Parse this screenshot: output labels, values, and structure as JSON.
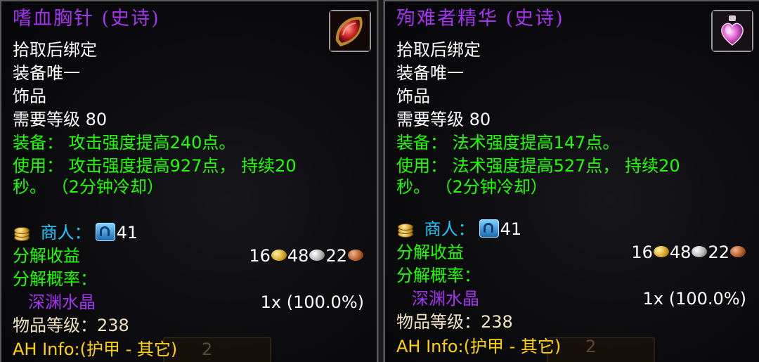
{
  "tooltips": [
    {
      "name": "嗜血胸针 (史诗)",
      "bind": "拾取后绑定",
      "unique": "装备唯一",
      "slot": "饰品",
      "req_level": "需要等级 80",
      "equip": "装备：  攻击强度提高240点。",
      "use_line1": "使用：  攻击强度提高927点， 持续20",
      "use_line2": "秒。  （2分钟冷却）",
      "vendor_label": "商人：",
      "vendor_amount": "41",
      "disenchant_label": "分解收益",
      "disenchant_gold": "16",
      "disenchant_silver": "48",
      "disenchant_copper": "22",
      "chance_label": "分解概率：",
      "material": "深渊水晶",
      "material_rate": "1x (100.0%)",
      "item_level": "物品等级：238",
      "ah_info": "AH Info:(护甲 - 其它)",
      "ghost_text": "2",
      "icon": "red-brooch-icon"
    },
    {
      "name": "殉难者精华 (史诗)",
      "bind": "拾取后绑定",
      "unique": "装备唯一",
      "slot": "饰品",
      "req_level": "需要等级 80",
      "equip": "装备：  法术强度提高147点。",
      "use_line1": "使用：  法术强度提高527点， 持续20",
      "use_line2": "秒。  （2分钟冷却）",
      "vendor_label": "商人：",
      "vendor_amount": "41",
      "disenchant_label": "分解收益",
      "disenchant_gold": "16",
      "disenchant_silver": "48",
      "disenchant_copper": "22",
      "chance_label": "分解概率：",
      "material": "深渊水晶",
      "material_rate": "1x (100.0%)",
      "item_level": "物品等级：238",
      "ah_info": "AH Info:(护甲 - 其它)",
      "ghost_text": "2",
      "icon": "pink-heart-vial-icon"
    }
  ],
  "colors": {
    "epic": "#a335ee",
    "green": "#1eff00",
    "cyan": "#1ec8ff",
    "gold": "#ffd200"
  }
}
